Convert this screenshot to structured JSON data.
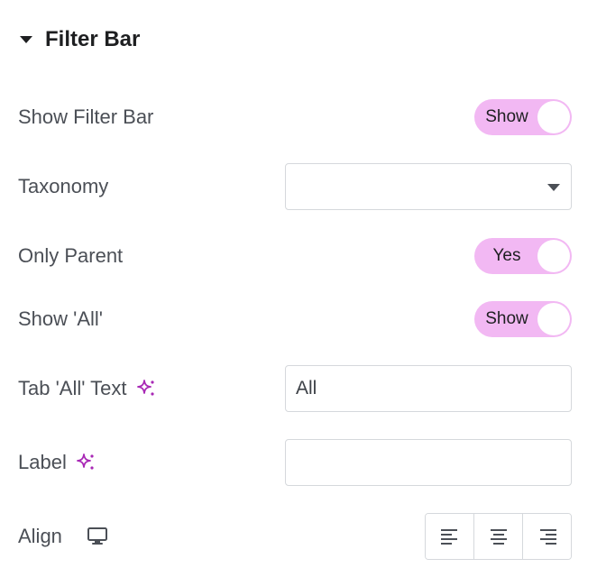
{
  "section": {
    "title": "Filter Bar",
    "caret_icon": "caret-down-icon"
  },
  "rows": {
    "show_filter_bar": {
      "label": "Show Filter Bar",
      "toggle_text": "Show",
      "on": true
    },
    "taxonomy": {
      "label": "Taxonomy",
      "selected": ""
    },
    "only_parent": {
      "label": "Only Parent",
      "toggle_text": "Yes",
      "on": true
    },
    "show_all": {
      "label": "Show 'All'",
      "toggle_text": "Show",
      "on": true
    },
    "tab_all_text": {
      "label": "Tab 'All' Text",
      "value": "All",
      "icon": "ai-sparkle-icon"
    },
    "label_field": {
      "label": "Label",
      "value": "",
      "icon": "ai-sparkle-icon"
    },
    "align": {
      "label": "Align",
      "device_icon": "desktop-icon",
      "options": [
        "left",
        "center",
        "right"
      ]
    }
  },
  "colors": {
    "toggle_on": "#f2b8f3",
    "ai_icon": "#a828b5",
    "label_text": "#4b4f56",
    "border": "#d5d8dc"
  }
}
